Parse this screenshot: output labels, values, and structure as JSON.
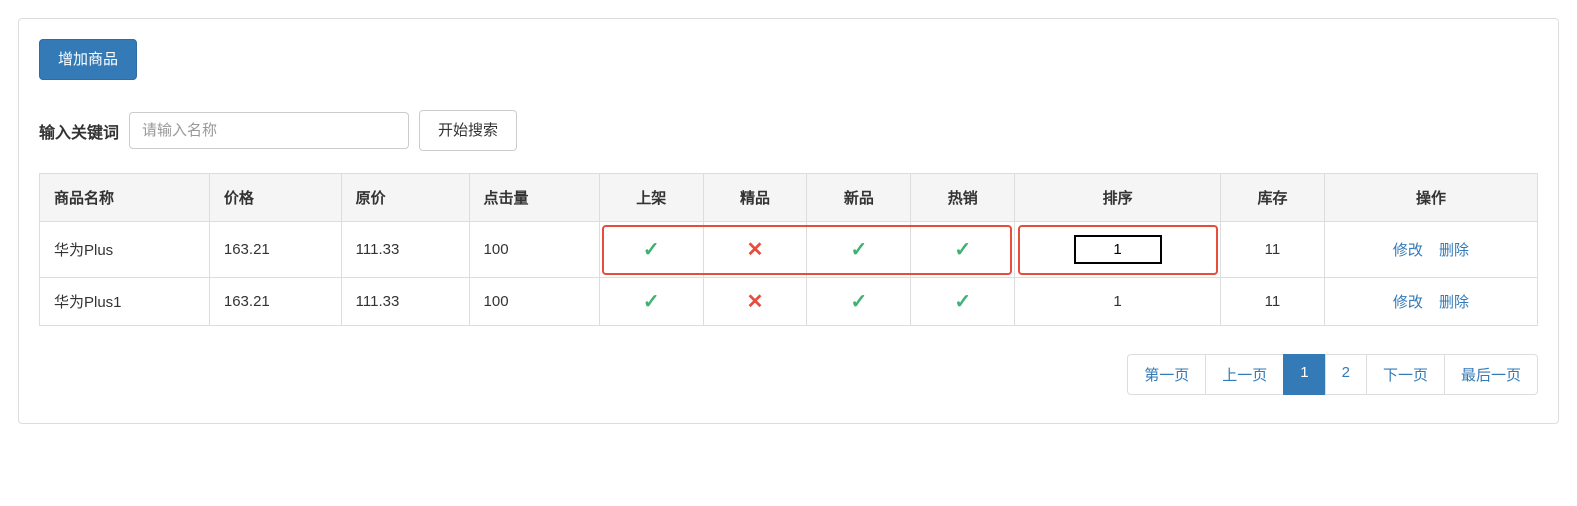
{
  "toolbar": {
    "add_label": "增加商品"
  },
  "search": {
    "label": "输入关键词",
    "placeholder": "请输入名称",
    "button": "开始搜索"
  },
  "table": {
    "headers": {
      "name": "商品名称",
      "price": "价格",
      "orig_price": "原价",
      "clicks": "点击量",
      "on_shelf": "上架",
      "featured": "精品",
      "new": "新品",
      "hot": "热销",
      "sort": "排序",
      "stock": "库存",
      "action": "操作"
    },
    "rows": [
      {
        "name": "华为Plus",
        "price": "163.21",
        "orig_price": "111.33",
        "clicks": "100",
        "on_shelf": true,
        "featured": false,
        "new": true,
        "hot": true,
        "sort": "1",
        "sort_editing": true,
        "stock": "11",
        "highlighted": true
      },
      {
        "name": "华为Plus1",
        "price": "163.21",
        "orig_price": "111.33",
        "clicks": "100",
        "on_shelf": true,
        "featured": false,
        "new": true,
        "hot": true,
        "sort": "1",
        "sort_editing": false,
        "stock": "11",
        "highlighted": false
      }
    ],
    "actions": {
      "edit": "修改",
      "delete": "删除"
    }
  },
  "pagination": {
    "first": "第一页",
    "prev": "上一页",
    "pages": [
      "1",
      "2"
    ],
    "active_index": 0,
    "next": "下一页",
    "last": "最后一页"
  }
}
